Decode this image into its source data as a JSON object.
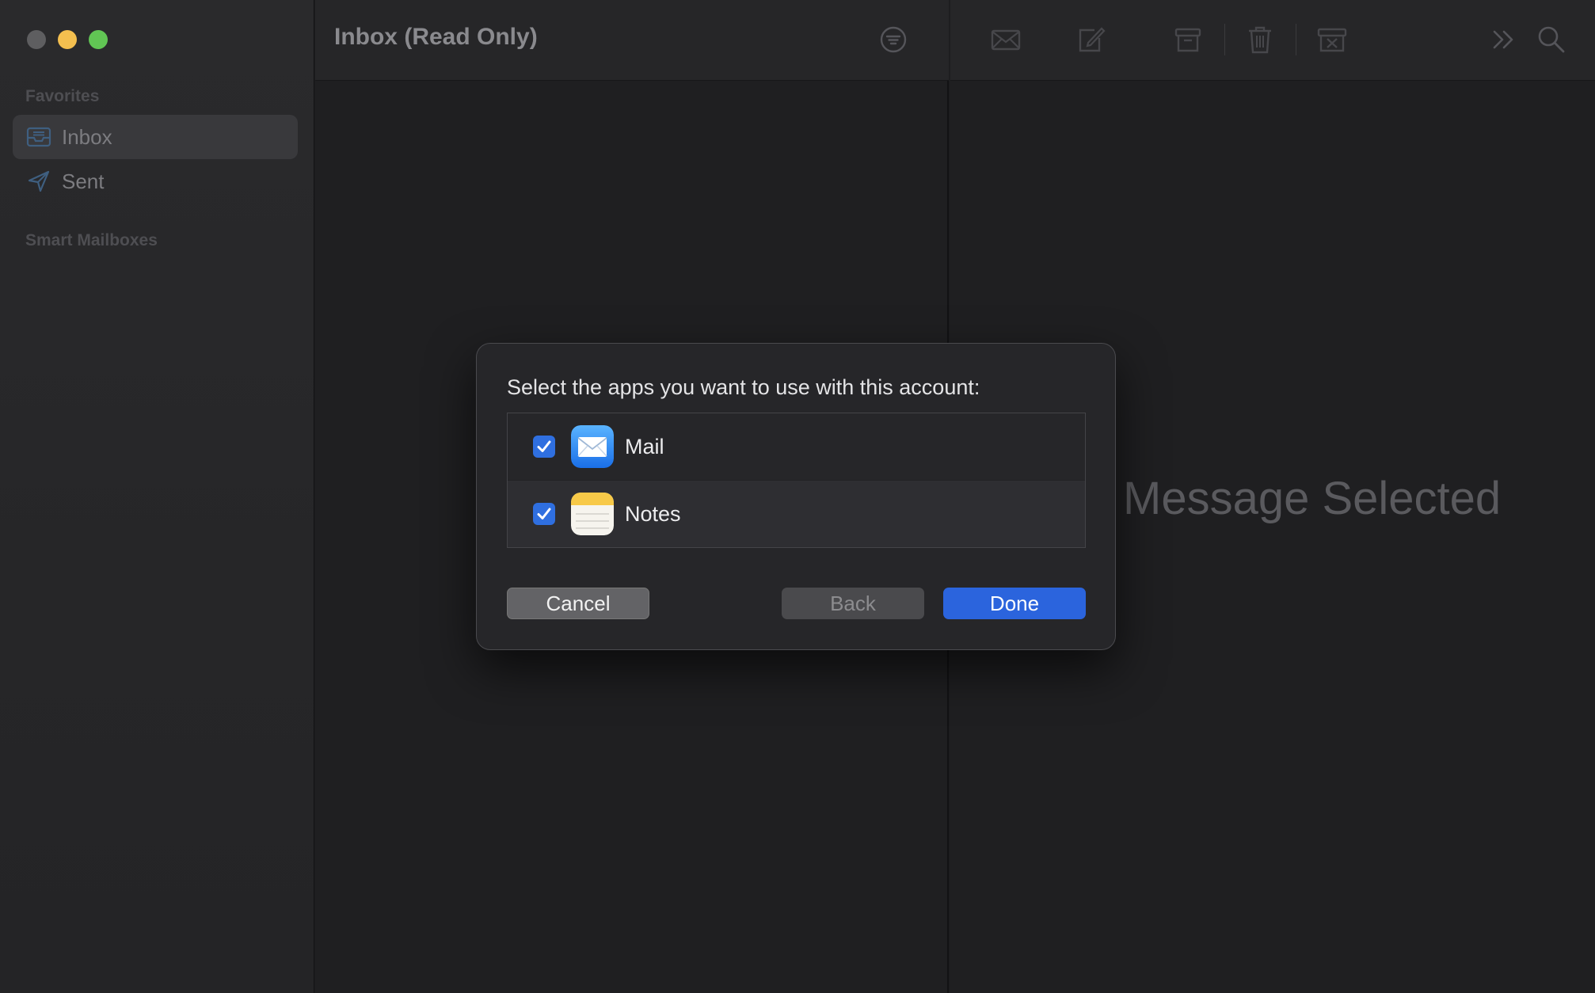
{
  "window": {
    "traffic_lights": [
      "close",
      "minimize",
      "zoom"
    ]
  },
  "sidebar": {
    "sections": {
      "favorites": "Favorites",
      "smart_mailboxes": "Smart Mailboxes"
    },
    "items": [
      {
        "label": "Inbox",
        "icon": "inbox-icon",
        "active": true
      },
      {
        "label": "Sent",
        "icon": "paper-plane-icon",
        "active": false
      }
    ]
  },
  "list_pane": {
    "title": "Inbox (Read Only)",
    "filter_icon": "filter-icon"
  },
  "message_pane": {
    "toolbar_icons": [
      "envelope-icon",
      "compose-icon",
      "archive-icon",
      "trash-icon",
      "junk-icon",
      "more-chevrons-icon",
      "search-icon"
    ],
    "placeholder": "Message Selected"
  },
  "dialog": {
    "prompt": "Select the apps you want to use with this account:",
    "apps": [
      {
        "name": "Mail",
        "checked": true,
        "icon": "mail-app-icon"
      },
      {
        "name": "Notes",
        "checked": true,
        "icon": "notes-app-icon"
      }
    ],
    "buttons": {
      "cancel": "Cancel",
      "back": "Back",
      "done": "Done"
    }
  },
  "colors": {
    "accent": "#2b64dd",
    "checkbox": "#2f6fe0",
    "traffic_close": "#5e5e60",
    "traffic_minimize": "#f4bf4f",
    "traffic_zoom": "#61c554"
  }
}
